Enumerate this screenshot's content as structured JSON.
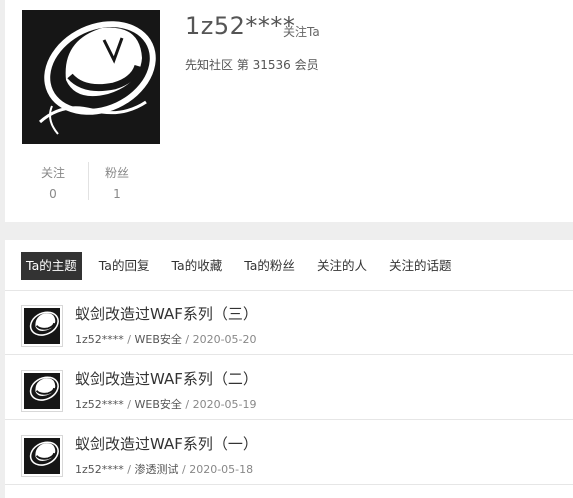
{
  "profile": {
    "username": "1z52****",
    "follow_label": "关注Ta",
    "member_text": "先知社区 第 31536 会员",
    "stats": [
      {
        "label": "关注",
        "value": "0"
      },
      {
        "label": "粉丝",
        "value": "1"
      }
    ],
    "avatar_icon": "fedora-hat-avatar-icon"
  },
  "tabs": [
    {
      "label": "Ta的主题",
      "active": true
    },
    {
      "label": "Ta的回复",
      "active": false
    },
    {
      "label": "Ta的收藏",
      "active": false
    },
    {
      "label": "Ta的粉丝",
      "active": false
    },
    {
      "label": "关注的人",
      "active": false
    },
    {
      "label": "关注的话题",
      "active": false
    }
  ],
  "topics": [
    {
      "title": "蚁剑改造过WAF系列（三）",
      "author": "1z52****",
      "category": "WEB安全",
      "date": "2020-05-20"
    },
    {
      "title": "蚁剑改造过WAF系列（二）",
      "author": "1z52****",
      "category": "WEB安全",
      "date": "2020-05-19"
    },
    {
      "title": "蚁剑改造过WAF系列（一）",
      "author": "1z52****",
      "category": "渗透测试",
      "date": "2020-05-18"
    }
  ],
  "meta_separator": "/",
  "colors": {
    "active_tab_bg": "#333333",
    "page_bg": "#eeeeee"
  }
}
